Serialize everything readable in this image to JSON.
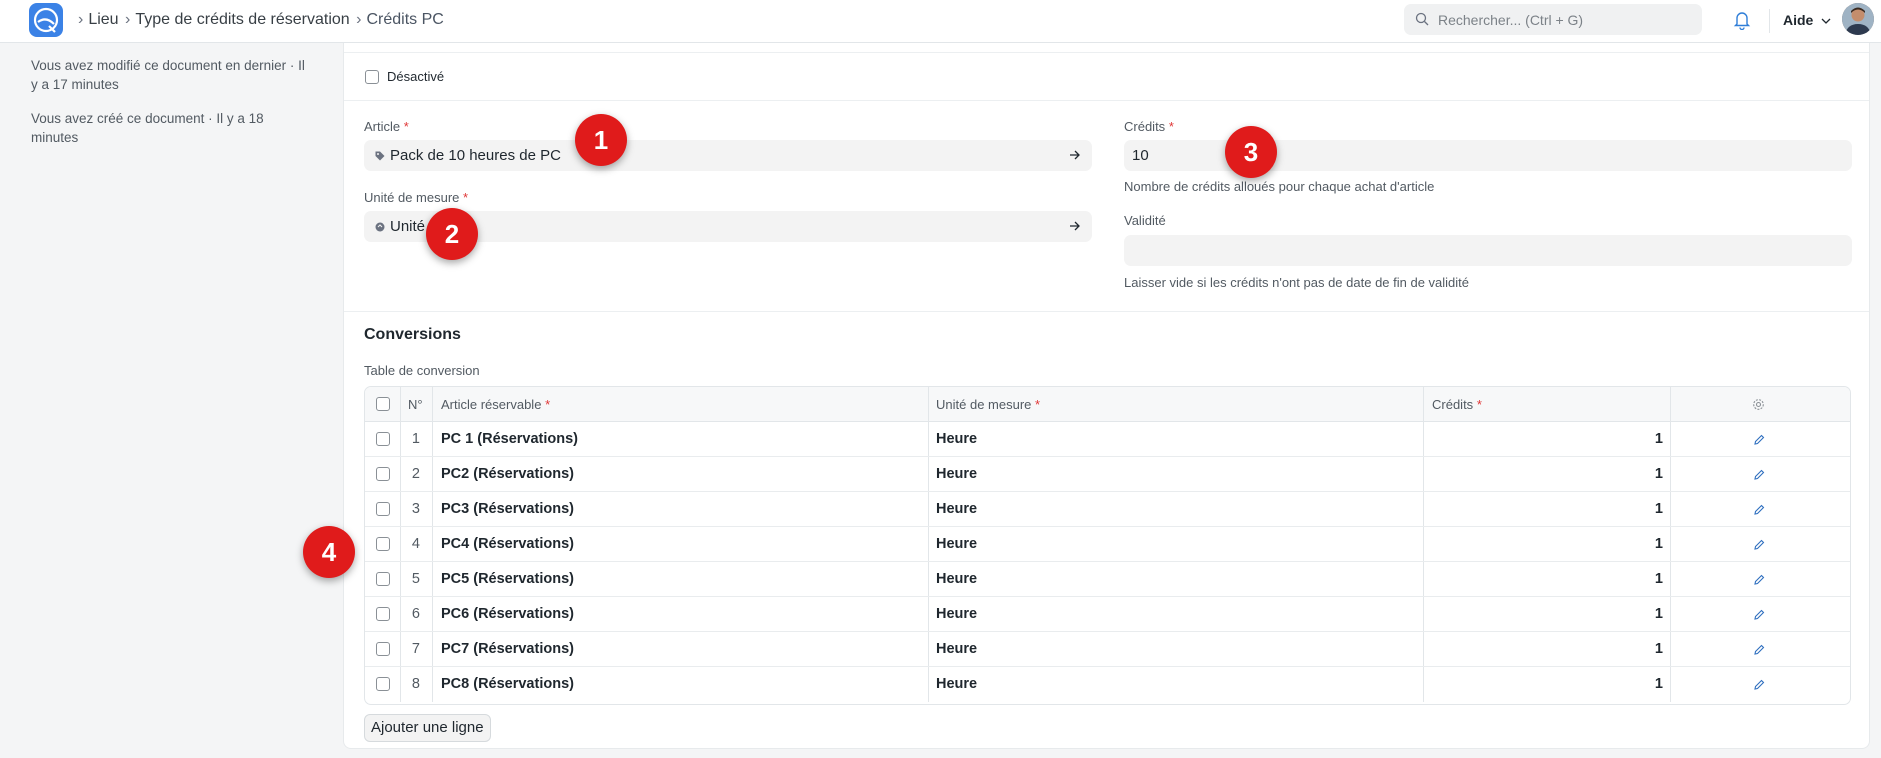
{
  "breadcrumb": {
    "items": [
      "Lieu",
      "Type de crédits de réservation"
    ],
    "current": "Crédits PC"
  },
  "search": {
    "placeholder": "Rechercher... (Ctrl + G)"
  },
  "help_label": "Aide",
  "sidebar": {
    "modified": "Vous avez modifié ce document en dernier · Il y a 17 minutes",
    "created": "Vous avez créé ce document · Il y a 18 minutes"
  },
  "form": {
    "disabled_label": "Désactivé",
    "article_label": "Article",
    "article_value": "Pack de 10 heures de PC",
    "uom_label": "Unité de mesure",
    "uom_value": "Unité",
    "credits_label": "Crédits",
    "credits_value": "10",
    "credits_help": "Nombre de crédits alloués pour chaque achat d'article",
    "validity_label": "Validité",
    "validity_value": "",
    "validity_help": "Laisser vide si les crédits n'ont pas de date de fin de validité"
  },
  "conversions": {
    "section_title": "Conversions",
    "table_label": "Table de conversion",
    "headers": {
      "no": "N°",
      "article": "Article réservable",
      "uom": "Unité de mesure",
      "credits": "Crédits"
    },
    "rows": [
      {
        "no": "1",
        "article": "PC 1 (Réservations)",
        "uom": "Heure",
        "credits": "1"
      },
      {
        "no": "2",
        "article": "PC2 (Réservations)",
        "uom": "Heure",
        "credits": "1"
      },
      {
        "no": "3",
        "article": "PC3 (Réservations)",
        "uom": "Heure",
        "credits": "1"
      },
      {
        "no": "4",
        "article": "PC4 (Réservations)",
        "uom": "Heure",
        "credits": "1"
      },
      {
        "no": "5",
        "article": "PC5 (Réservations)",
        "uom": "Heure",
        "credits": "1"
      },
      {
        "no": "6",
        "article": "PC6 (Réservations)",
        "uom": "Heure",
        "credits": "1"
      },
      {
        "no": "7",
        "article": "PC7 (Réservations)",
        "uom": "Heure",
        "credits": "1"
      },
      {
        "no": "8",
        "article": "PC8 (Réservations)",
        "uom": "Heure",
        "credits": "1"
      }
    ],
    "add_row_label": "Ajouter une ligne"
  },
  "markers": [
    "1",
    "2",
    "3",
    "4"
  ],
  "colors": {
    "marker": "#e01b1b",
    "required": "#e03636",
    "logo": "#3b82e6"
  }
}
